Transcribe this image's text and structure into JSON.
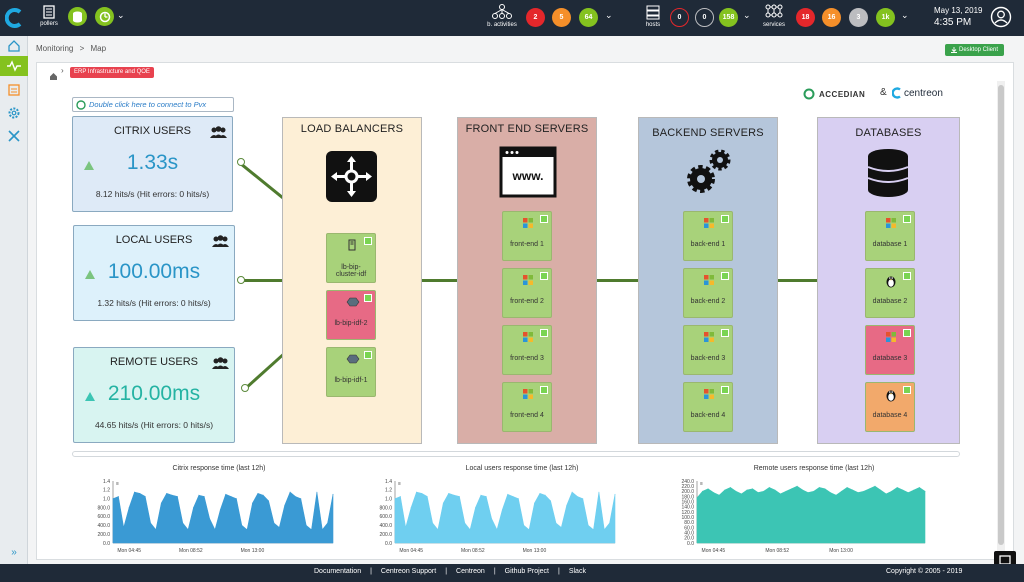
{
  "topbar": {
    "pollers_label": "pollers",
    "b_activities_label": "b. activities",
    "b_activities_counts": [
      "2",
      "5",
      "64"
    ],
    "hosts_label": "hosts",
    "hosts_counts": [
      "0",
      "0",
      "158"
    ],
    "services_label": "services",
    "services_counts": [
      "18",
      "16",
      "3",
      "1k"
    ],
    "date": "May 13, 2019",
    "time": "4:35 PM"
  },
  "breadcrumb": {
    "section": "Monitoring",
    "sep": ">",
    "page": "Map"
  },
  "desktop_client": "Desktop Client",
  "map": {
    "tag": "ERP Infrastructure and QOE",
    "connect_hint": "Double click here to connect to Pvx",
    "brand_left": "ACCEDIAN",
    "brand_amp": "&",
    "brand_right": "centreon",
    "users": [
      {
        "title": "CITRIX USERS",
        "value": "1.33s",
        "stats": "8.12 hits/s (Hit errors: 0 hits/s)"
      },
      {
        "title": "LOCAL USERS",
        "value": "100.00ms",
        "stats": "1.32 hits/s (Hit errors: 0 hits/s)"
      },
      {
        "title": "REMOTE USERS",
        "value": "210.00ms",
        "stats": "44.65 hits/s (Hit errors: 0 hits/s)"
      }
    ],
    "columns": [
      {
        "title": "LOAD BALANCERS",
        "nodes": [
          "lb-bip-cluster-idf",
          "lb-bip-idf-2",
          "lb-bip-idf-1"
        ]
      },
      {
        "title": "FRONT END SERVERS",
        "nodes": [
          "front-end 1",
          "front-end 2",
          "front-end 3",
          "front-end 4"
        ]
      },
      {
        "title": "BACKEND SERVERS",
        "nodes": [
          "back-end 1",
          "back-end 2",
          "back-end 3",
          "back-end 4"
        ]
      },
      {
        "title": "DATABASES",
        "nodes": [
          "database 1",
          "database 2",
          "database 3",
          "database 4"
        ]
      }
    ],
    "www_label": "www."
  },
  "chart_data": [
    {
      "type": "area",
      "title": "Citrix response time (last 12h)",
      "yticks": [
        "1.4",
        "1.2",
        "1.0",
        "800.0",
        "600.0",
        "400.0",
        "200.0",
        "0.0"
      ],
      "xticks": [
        "Mon 04:45",
        "Mon 08:52",
        "Mon 13:00"
      ],
      "ylim": [
        0,
        1.4
      ],
      "color": "#3a9ad4",
      "values": [
        1.0,
        1.05,
        0.35,
        0.8,
        1.15,
        1.12,
        1.05,
        0.45,
        0.3,
        0.9,
        1.12,
        1.08,
        1.05,
        0.45,
        0.3,
        0.8,
        1.08,
        1.05,
        0.55,
        0.3,
        0.75,
        1.1,
        1.05,
        1.0,
        0.4,
        0.3,
        0.9,
        1.12,
        1.08,
        0.95,
        0.45,
        0.35,
        0.85,
        1.15,
        1.05,
        1.0,
        0.4,
        0.3,
        1.15,
        0.3,
        0.45,
        1.1
      ]
    },
    {
      "type": "area",
      "title": "Local users response time (last 12h)",
      "yticks": [
        "1.4",
        "1.2",
        "1.0",
        "800.0",
        "600.0",
        "400.0",
        "200.0",
        "0.0"
      ],
      "xticks": [
        "Mon 04:45",
        "Mon 08:52",
        "Mon 13:00"
      ],
      "ylim": [
        0,
        1.4
      ],
      "color": "#6fcff0",
      "values": [
        1.0,
        1.05,
        0.35,
        0.8,
        1.15,
        1.12,
        1.05,
        0.45,
        0.3,
        0.9,
        1.12,
        1.08,
        1.05,
        0.45,
        0.3,
        0.8,
        1.08,
        1.05,
        0.55,
        0.3,
        0.75,
        1.1,
        1.05,
        1.0,
        0.4,
        0.3,
        0.9,
        1.12,
        1.08,
        0.95,
        0.45,
        0.35,
        0.85,
        1.15,
        1.05,
        1.0,
        0.4,
        0.3,
        1.15,
        0.3,
        0.45,
        1.1
      ]
    },
    {
      "type": "area",
      "title": "Remote users response time (last 12h)",
      "yticks": [
        "240.0",
        "220.0",
        "200.0",
        "180.0",
        "160.0",
        "140.0",
        "120.0",
        "100.0",
        "80.0",
        "60.0",
        "40.0",
        "20.0",
        "0.0"
      ],
      "xticks": [
        "Mon 04:45",
        "Mon 08:52",
        "Mon 13:00"
      ],
      "ylim": [
        0,
        240
      ],
      "color": "#3cc5b4",
      "values": [
        175,
        200,
        210,
        195,
        185,
        205,
        215,
        200,
        190,
        205,
        210,
        195,
        200,
        215,
        205,
        190,
        200,
        210,
        220,
        205,
        195,
        200,
        215,
        210,
        195,
        185,
        200,
        215,
        205,
        195,
        200,
        210,
        220,
        205,
        190,
        200,
        215,
        205,
        195,
        205,
        215,
        200
      ]
    }
  ],
  "footer": {
    "links": [
      "Documentation",
      "Centreon Support",
      "Centreon",
      "Github Project",
      "Slack"
    ],
    "copyright": "Copyright © 2005 - 2019"
  },
  "colors": {
    "topbar": "#1f2a38",
    "critical": "#e4272b",
    "warning": "#f58f2a",
    "ok": "#84c21f",
    "unknown": "#bcbdc0",
    "tag": "#e8424f",
    "lb": "#fdefd6",
    "fe": "#d9aea7",
    "be": "#b5c6db",
    "db": "#d8cff2"
  }
}
